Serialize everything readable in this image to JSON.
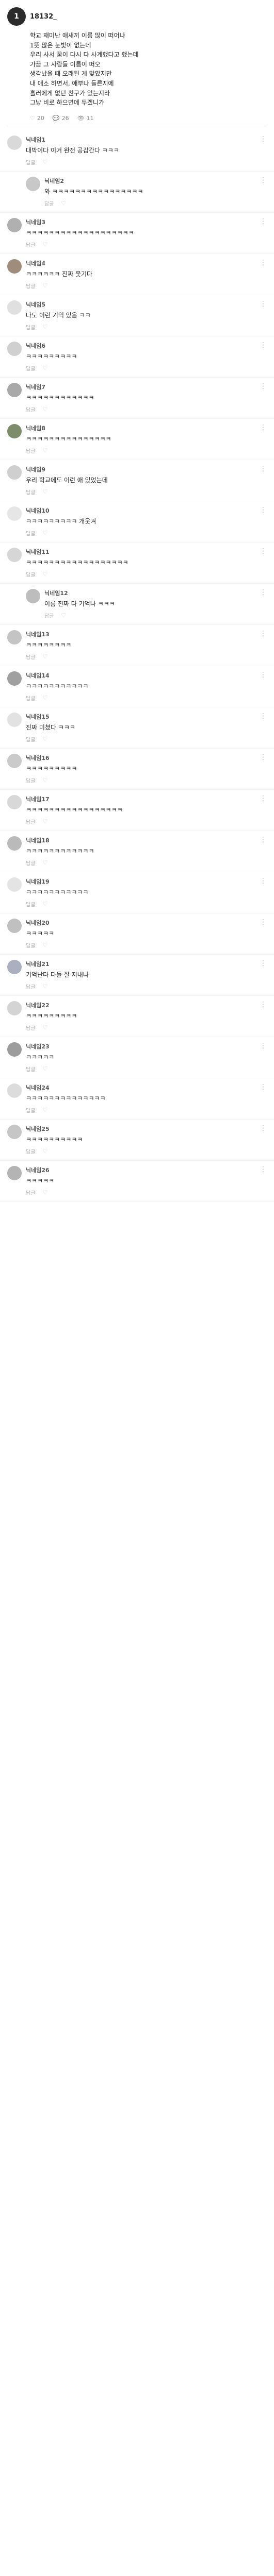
{
  "post": {
    "author": "18132_",
    "avatar_initial": "1",
    "avatar_color": "#2b2b2b",
    "lines": [
      "학교 재미난 애새끼 이름 많이 떠어나",
      "1뜻 많은 눈빛이 없는데",
      "우리 사서 꿈이 다시 다 사계했다고 했는데",
      "가끔 그 사람들 이름이 떠오",
      "생각났을 때 오래된 게 맞았지만",
      "내 애소 하면서, 애부나 들른지에",
      "흘러에게 없던 친구가 있는지라",
      "그냥 비로 하으면에 두겠니가"
    ],
    "likes": "20",
    "comments_count": "26",
    "views": "11"
  },
  "comments": [
    {
      "name": "닉네임1",
      "time": "",
      "text": "대박이다 이거 완전 공감간다 ㅋㅋㅋ",
      "reply": false,
      "color": "#d9d9d9"
    },
    {
      "name": "닉네임2",
      "time": "",
      "text": "와 ㅋㅋㅋㅋㅋㅋㅋㅋㅋㅋㅋㅋㅋㅋㅋㅋ",
      "reply": true,
      "color": "#c8c8c8"
    },
    {
      "name": "닉네임3",
      "time": "",
      "text": "ㅋㅋㅋㅋㅋㅋㅋㅋㅋㅋㅋㅋㅋㅋㅋㅋㅋㅋㅋ",
      "reply": false,
      "color": "#b0b0b0"
    },
    {
      "name": "닉네임4",
      "time": "",
      "text": "ㅋㅋㅋㅋㅋㅋ 진짜 웃기다",
      "reply": false,
      "color": "#9f8c7a"
    },
    {
      "name": "닉네임5",
      "time": "",
      "text": "나도 이런 기억 있음 ㅋㅋ",
      "reply": false,
      "color": "#e0e0e0"
    },
    {
      "name": "닉네임6",
      "time": "",
      "text": "ㅋㅋㅋㅋㅋㅋㅋㅋㅋ",
      "reply": false,
      "color": "#d0d0d0"
    },
    {
      "name": "닉네임7",
      "time": "",
      "text": "ㅋㅋㅋㅋㅋㅋㅋㅋㅋㅋㅋㅋ",
      "reply": false,
      "color": "#a9a9a9"
    },
    {
      "name": "닉네임8",
      "time": "",
      "text": "ㅋㅋㅋㅋㅋㅋㅋㅋㅋㅋㅋㅋㅋㅋㅋ",
      "reply": false,
      "color": "#7d8c6a"
    },
    {
      "name": "닉네임9",
      "time": "",
      "text": "우리 학교에도 이런 애 있었는데",
      "reply": false,
      "color": "#cfcfcf"
    },
    {
      "name": "닉네임10",
      "time": "",
      "text": "ㅋㅋㅋㅋㅋㅋㅋㅋㅋ 개웃겨",
      "reply": false,
      "color": "#e6e6e6"
    },
    {
      "name": "닉네임11",
      "time": "",
      "text": "ㅋㅋㅋㅋㅋㅋㅋㅋㅋㅋㅋㅋㅋㅋㅋㅋㅋㅋ",
      "reply": false,
      "color": "#d6d6d6"
    },
    {
      "name": "닉네임12",
      "time": "",
      "text": "이름 진짜 다 기억나 ㅋㅋㅋ",
      "reply": true,
      "color": "#bdbdbd"
    },
    {
      "name": "닉네임13",
      "time": "",
      "text": "ㅋㅋㅋㅋㅋㅋㅋㅋ",
      "reply": false,
      "color": "#c4c4c4"
    },
    {
      "name": "닉네임14",
      "time": "",
      "text": "ㅋㅋㅋㅋㅋㅋㅋㅋㅋㅋㅋ",
      "reply": false,
      "color": "#a0a0a0"
    },
    {
      "name": "닉네임15",
      "time": "",
      "text": "진짜 미쳤다 ㅋㅋㅋ",
      "reply": false,
      "color": "#e2e2e2"
    },
    {
      "name": "닉네임16",
      "time": "",
      "text": "ㅋㅋㅋㅋㅋㅋㅋㅋㅋ",
      "reply": false,
      "color": "#cacaca"
    },
    {
      "name": "닉네임17",
      "time": "",
      "text": "ㅋㅋㅋㅋㅋㅋㅋㅋㅋㅋㅋㅋㅋㅋㅋㅋㅋ",
      "reply": false,
      "color": "#d8d8d8"
    },
    {
      "name": "닉네임18",
      "time": "",
      "text": "ㅋㅋㅋㅋㅋㅋㅋㅋㅋㅋㅋㅋ",
      "reply": false,
      "color": "#bababa"
    },
    {
      "name": "닉네임19",
      "time": "",
      "text": "ㅋㅋㅋㅋㅋㅋㅋㅋㅋㅋㅋ",
      "reply": false,
      "color": "#e4e4e4"
    },
    {
      "name": "닉네임20",
      "time": "",
      "text": "ㅋㅋㅋㅋㅋ",
      "reply": false,
      "color": "#c0c0c0"
    },
    {
      "name": "닉네임21",
      "time": "",
      "text": "기억난다 다들 잘 지내나",
      "reply": false,
      "color": "#aab0c0"
    },
    {
      "name": "닉네임22",
      "time": "",
      "text": "ㅋㅋㅋㅋㅋㅋㅋㅋㅋ",
      "reply": false,
      "color": "#d4d4d4"
    },
    {
      "name": "닉네임23",
      "time": "",
      "text": "ㅋㅋㅋㅋㅋ",
      "reply": false,
      "color": "#9c9c9c"
    },
    {
      "name": "닉네임24",
      "time": "",
      "text": "ㅋㅋㅋㅋㅋㅋㅋㅋㅋㅋㅋㅋㅋㅋ",
      "reply": false,
      "color": "#dcdcdc"
    },
    {
      "name": "닉네임25",
      "time": "",
      "text": "ㅋㅋㅋㅋㅋㅋㅋㅋㅋㅋ",
      "reply": false,
      "color": "#c6c6c6"
    },
    {
      "name": "닉네임26",
      "time": "",
      "text": "ㅋㅋㅋㅋㅋ",
      "reply": false,
      "color": "#b4b4b4"
    }
  ],
  "labels": {
    "like_icon": "heart-icon",
    "reply": "답글",
    "more": "⋮"
  }
}
